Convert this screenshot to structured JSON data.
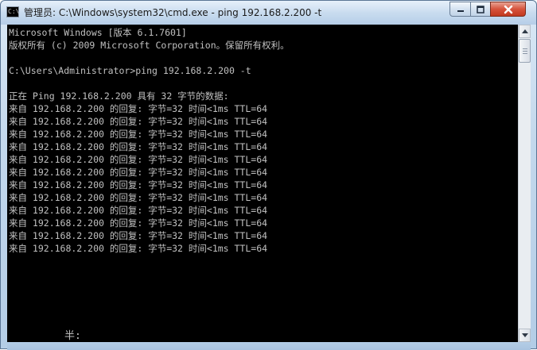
{
  "window": {
    "title": "管理员: C:\\Windows\\system32\\cmd.exe - ping  192.168.2.200 -t",
    "icon": "cmd-icon",
    "icon_glyph": "C:\\"
  },
  "controls": {
    "minimize": "minimize-icon",
    "maximize": "maximize-icon",
    "close": "close-icon"
  },
  "console": {
    "lines": [
      "Microsoft Windows [版本 6.1.7601]",
      "版权所有 (c) 2009 Microsoft Corporation。保留所有权利。",
      "",
      "C:\\Users\\Administrator>ping 192.168.2.200 -t",
      "",
      "正在 Ping 192.168.2.200 具有 32 字节的数据:",
      "来自 192.168.2.200 的回复: 字节=32 时间<1ms TTL=64",
      "来自 192.168.2.200 的回复: 字节=32 时间<1ms TTL=64",
      "来自 192.168.2.200 的回复: 字节=32 时间<1ms TTL=64",
      "来自 192.168.2.200 的回复: 字节=32 时间<1ms TTL=64",
      "来自 192.168.2.200 的回复: 字节=32 时间<1ms TTL=64",
      "来自 192.168.2.200 的回复: 字节=32 时间<1ms TTL=64",
      "来自 192.168.2.200 的回复: 字节=32 时间<1ms TTL=64",
      "来自 192.168.2.200 的回复: 字节=32 时间<1ms TTL=64",
      "来自 192.168.2.200 的回复: 字节=32 时间<1ms TTL=64",
      "来自 192.168.2.200 的回复: 字节=32 时间<1ms TTL=64",
      "来自 192.168.2.200 的回复: 字节=32 时间<1ms TTL=64",
      "来自 192.168.2.200 的回复: 字节=32 时间<1ms TTL=64"
    ],
    "ime_status": "半:",
    "text_color": "#c0c0c0",
    "background_color": "#000000"
  },
  "scrollbar": {
    "up": "scroll-up-arrow-icon",
    "down": "scroll-down-arrow-icon"
  }
}
